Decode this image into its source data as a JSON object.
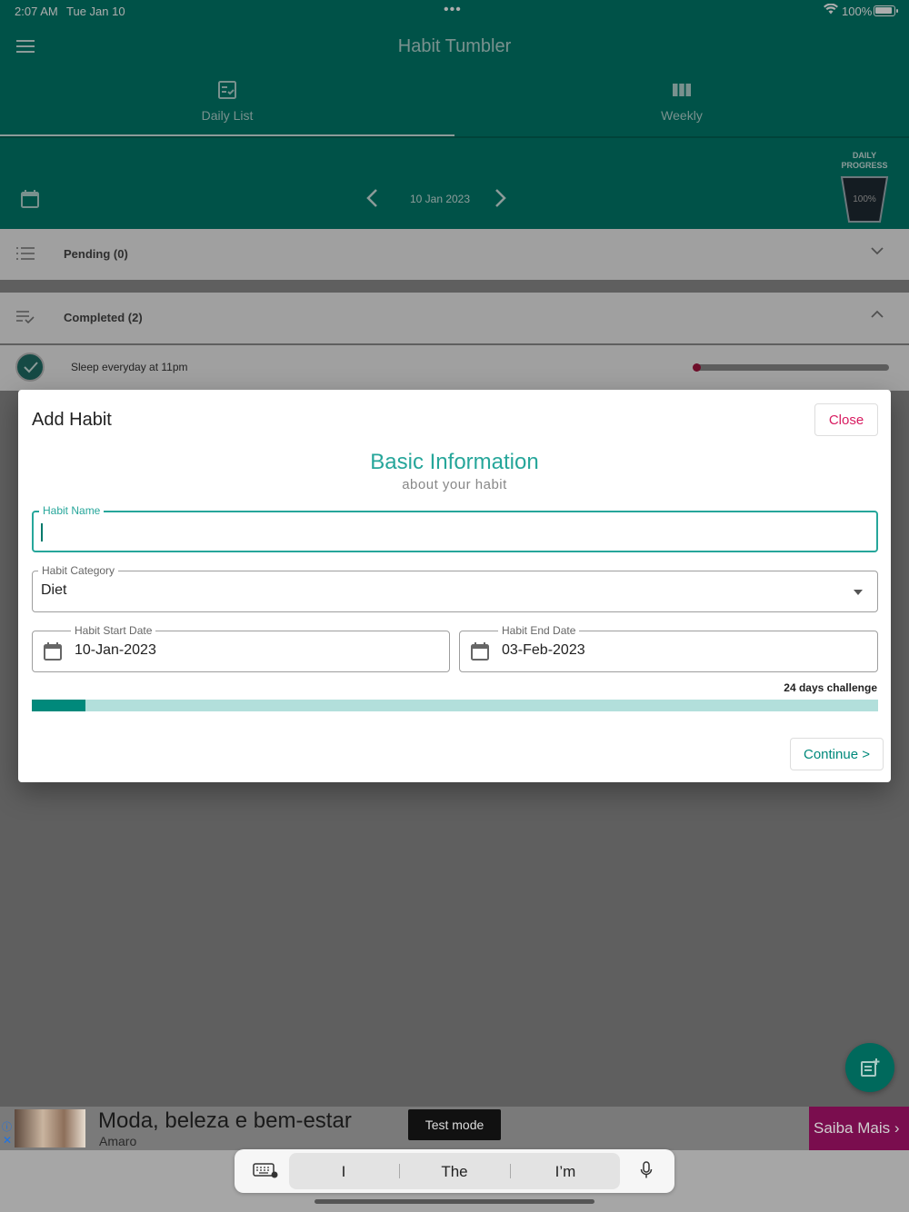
{
  "status_bar": {
    "time": "2:07 AM",
    "date": "Tue Jan 10",
    "battery": "100%"
  },
  "app": {
    "title": "Habit Tumbler"
  },
  "tabs": [
    {
      "label": "Daily List",
      "icon": "daily-list-icon",
      "selected": true
    },
    {
      "label": "Weekly",
      "icon": "weekly-columns-icon",
      "selected": false
    }
  ],
  "date_nav": {
    "current_date": "10 Jan 2023"
  },
  "daily_progress": {
    "label": "DAILY PROGRESS",
    "value": "100%"
  },
  "sections": {
    "pending": {
      "title": "Pending (0)",
      "expanded": false
    },
    "completed": {
      "title": "Completed (2)",
      "expanded": true
    }
  },
  "completed_habits": [
    {
      "name": "Sleep everyday at 11pm"
    }
  ],
  "dialog": {
    "title": "Add Habit",
    "close_label": "Close",
    "heading": "Basic Information",
    "subheading": "about your habit",
    "habit_name": {
      "label": "Habit Name",
      "value": ""
    },
    "habit_category": {
      "label": "Habit Category",
      "value": "Diet"
    },
    "start_date": {
      "label": "Habit Start Date",
      "value": "10-Jan-2023"
    },
    "end_date": {
      "label": "Habit End Date",
      "value": "03-Feb-2023"
    },
    "challenge_text": "24 days challenge",
    "challenge_progress": 0.063,
    "continue_label": "Continue >"
  },
  "ad": {
    "headline": "Moda, beleza e bem-estar",
    "advertiser": "Amaro",
    "test_mode": "Test mode",
    "cta": "Saiba Mais"
  },
  "keyboard": {
    "suggestions": [
      "I",
      "The",
      "I’m"
    ]
  },
  "colors": {
    "primary": "#00796b",
    "accent": "#26a69a",
    "close": "#d81b60",
    "ad_cta": "#7a0d4e"
  }
}
